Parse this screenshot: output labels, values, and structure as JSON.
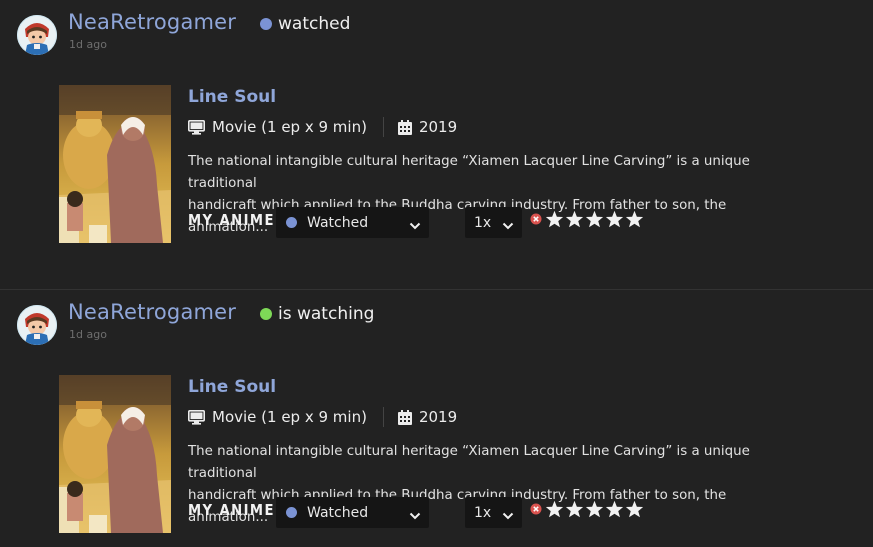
{
  "activities": [
    {
      "user": "NeaRetrogamer",
      "action": "watched",
      "action_color": "#7b93d4",
      "time_ago": "1d ago",
      "anime": {
        "title": "Line Soul",
        "type": "Movie (1 ep x 9 min)",
        "year": "2019",
        "synopsis_line1": "The national intangible cultural heritage “Xiamen Lacquer Line Carving” is a unique traditional",
        "synopsis_line2": "handicraft which applied to the Buddha carving industry. From father to son, the animation..."
      },
      "my_anime_label": "MY ANIME:",
      "status_value": "Watched",
      "rewatch_value": "1x",
      "rating_stars": 5
    },
    {
      "user": "NeaRetrogamer",
      "action": "is watching",
      "action_color": "#7ed957",
      "time_ago": "1d ago",
      "anime": {
        "title": "Line Soul",
        "type": "Movie (1 ep x 9 min)",
        "year": "2019",
        "synopsis_line1": "The national intangible cultural heritage “Xiamen Lacquer Line Carving” is a unique traditional",
        "synopsis_line2": "handicraft which applied to the Buddha carving industry. From father to son, the animation..."
      },
      "my_anime_label": "MY ANIME:",
      "status_value": "Watched",
      "rewatch_value": "1x",
      "rating_stars": 5
    }
  ],
  "icons": {
    "type_icon": "monitor-icon",
    "year_icon": "calendar-icon",
    "dropdown_icon": "chevron-down-icon",
    "clear_icon": "clear-rating-icon",
    "star_icon": "star-icon"
  },
  "colors": {
    "background": "#222222",
    "link": "#8fa6d9",
    "watched": "#7b93d4",
    "watching": "#7ed957",
    "clear_rating": "#d9534f"
  }
}
